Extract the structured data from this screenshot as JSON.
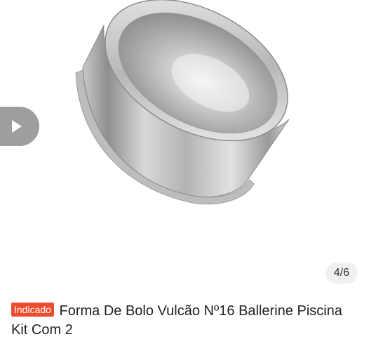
{
  "gallery": {
    "image_alt": "",
    "video_icon": "play-icon",
    "counter": "4/6"
  },
  "product": {
    "badge": "Indicado",
    "title": "Forma De Bolo Vulcão Nº16 Ballerine Piscina Kit Com 2"
  },
  "colors": {
    "badge_bg": "#ee4d2d",
    "counter_bg": "#f1f1f1",
    "video_bg": "#787878"
  }
}
